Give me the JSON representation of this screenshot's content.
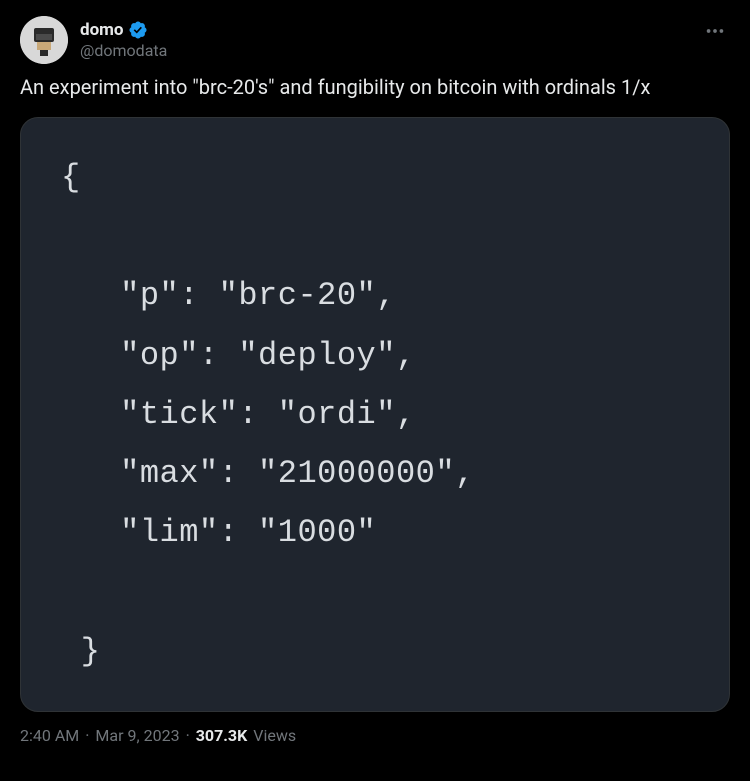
{
  "user": {
    "display_name": "domo",
    "handle": "@domodata"
  },
  "tweet": {
    "text": "An experiment into \"brc-20's\" and fungibility on bitcoin with ordinals 1/x"
  },
  "code": {
    "content": "{\n\n   \"p\": \"brc-20\",\n   \"op\": \"deploy\",\n   \"tick\": \"ordi\",\n   \"max\": \"21000000\",\n   \"lim\": \"1000\"\n\n }"
  },
  "footer": {
    "time": "2:40 AM",
    "date": "Mar 9, 2023",
    "views_count": "307.3K",
    "views_label": "Views"
  }
}
